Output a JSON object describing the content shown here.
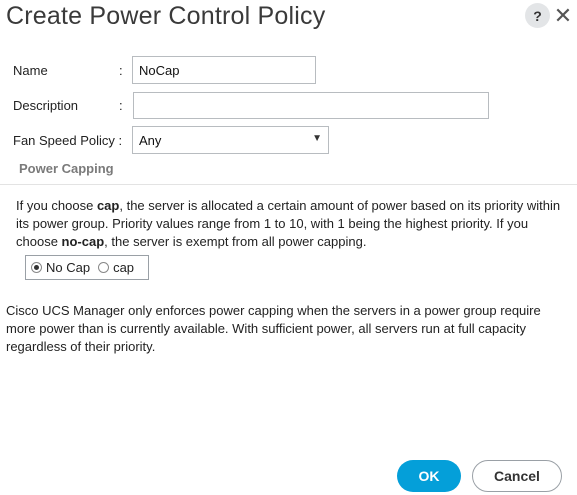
{
  "dialog": {
    "title": "Create Power Control Policy",
    "help_glyph": "?",
    "close_glyph": "✕"
  },
  "form": {
    "name_label": "Name",
    "name_value": "NoCap",
    "description_label": "Description",
    "description_value": "",
    "fan_speed_label": "Fan Speed Policy :",
    "fan_speed_value": "Any",
    "colon": ":"
  },
  "power_capping": {
    "section_title": "Power Capping",
    "text_1": "If you choose ",
    "term_cap": "cap",
    "text_2": ", the server is allocated a certain amount of power based on its priority within its power group. Priority values range from 1 to 10, with 1 being the highest priority. If you choose ",
    "term_nocap": "no-cap",
    "text_3": ", the server is exempt from all power capping.",
    "options": [
      {
        "label": "No Cap",
        "selected": true
      },
      {
        "label": "cap",
        "selected": false
      }
    ]
  },
  "footnote": "Cisco UCS Manager only enforces power capping when the servers in a power group require more power than is currently available. With sufficient power, all servers run at full capacity regardless of their priority.",
  "buttons": {
    "ok": "OK",
    "cancel": "Cancel"
  },
  "colors": {
    "accent": "#049fd9"
  }
}
